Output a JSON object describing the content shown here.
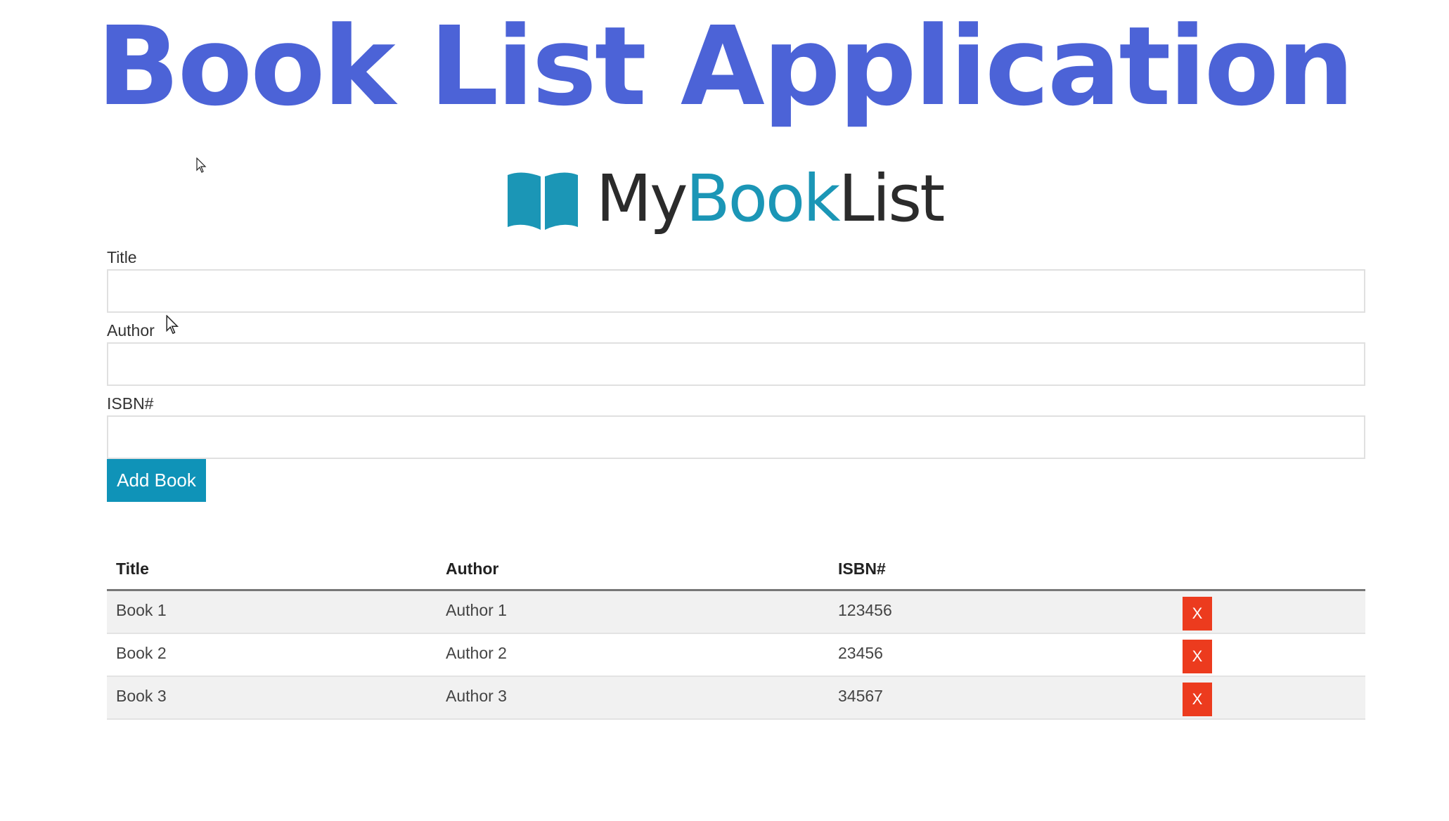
{
  "header": {
    "title": "Book List Application"
  },
  "logo": {
    "part_my": "My",
    "part_book": "Book",
    "part_list": "List",
    "icon": "open-book-icon",
    "colors": {
      "icon": "#1b96b6",
      "dark_text": "#2b2b2b",
      "teal_text": "#1b96b6"
    }
  },
  "form": {
    "title_label": "Title",
    "title_value": "",
    "author_label": "Author",
    "author_value": "",
    "isbn_label": "ISBN#",
    "isbn_value": "",
    "add_button_label": "Add Book"
  },
  "table": {
    "headers": [
      "Title",
      "Author",
      "ISBN#",
      ""
    ],
    "rows": [
      {
        "title": "Book 1",
        "author": "Author 1",
        "isbn": "123456",
        "delete_label": "X"
      },
      {
        "title": "Book 2",
        "author": "Author 2",
        "isbn": "23456",
        "delete_label": "X"
      },
      {
        "title": "Book 3",
        "author": "Author 3",
        "isbn": "34567",
        "delete_label": "X"
      }
    ]
  },
  "colors": {
    "heading": "#4c63d7",
    "primary_button": "#0f93b8",
    "delete_button": "#ec3b1e",
    "striped_row": "#f1f1f1"
  }
}
